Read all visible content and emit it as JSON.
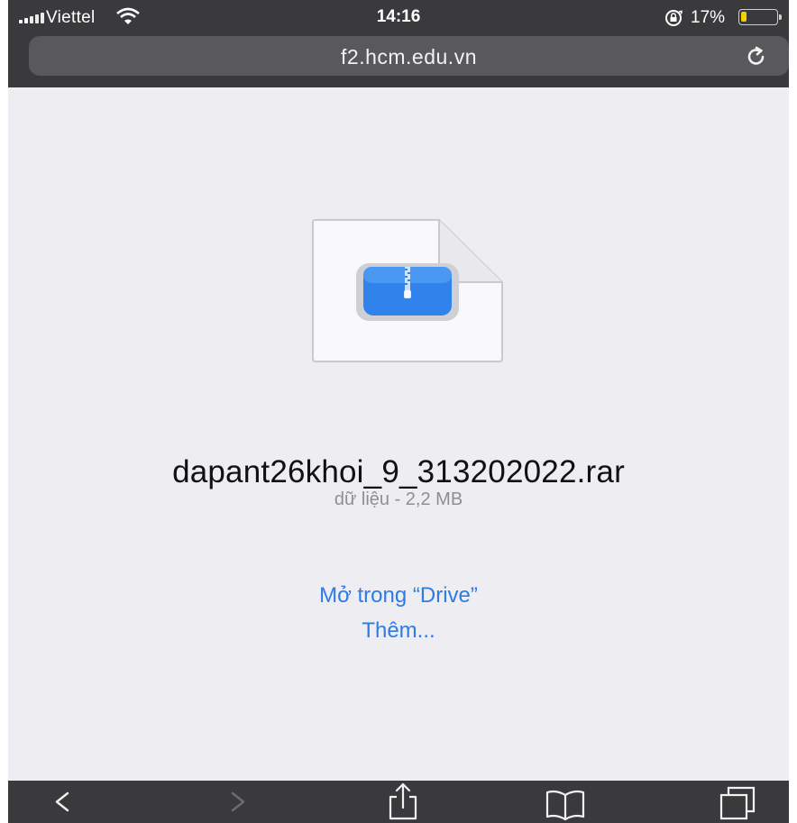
{
  "status_bar": {
    "carrier": "Viettel",
    "time": "14:16",
    "battery_percent": "17%",
    "battery_level": 0.17,
    "battery_color": "#f5d000",
    "icons": [
      "signal-bars",
      "wifi",
      "orientation-lock",
      "battery"
    ]
  },
  "url_bar": {
    "url": "f2.hcm.edu.vn",
    "reload_icon": "reload-icon"
  },
  "file": {
    "icon": "archive-file-icon",
    "name": "dapant26khoi_9_313202022.rar",
    "info": "dữ liệu - 2,2 MB"
  },
  "actions": {
    "open_in_drive": "Mở trong “Drive”",
    "more": "Thêm..."
  },
  "toolbar": {
    "items": [
      "back-icon",
      "forward-icon",
      "share-icon",
      "bookmarks-icon",
      "tabs-icon"
    ]
  },
  "colors": {
    "accent": "#2d7be5",
    "bar_background": "#3a3a3c",
    "page_background": "#ededf2"
  }
}
